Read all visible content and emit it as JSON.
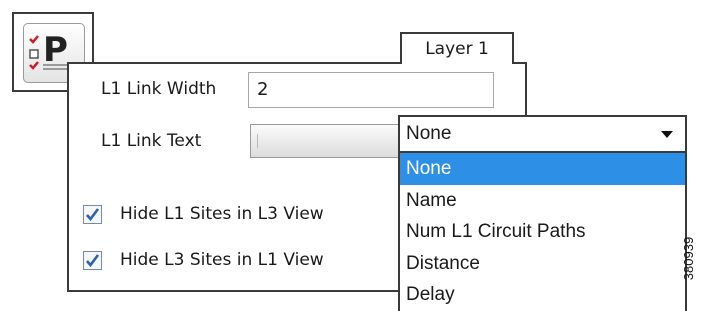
{
  "toolbar": {
    "properties_icon": "properties-icon"
  },
  "tab": {
    "label": "Layer 1"
  },
  "fields": {
    "link_width": {
      "label": "L1 Link Width",
      "value": "2"
    },
    "link_text": {
      "label": "L1 Link Text",
      "selected": "None"
    }
  },
  "checkboxes": [
    {
      "label": "Hide L1 Sites in L3 View",
      "checked": true
    },
    {
      "label": "Hide L3 Sites in L1 View",
      "checked": true
    }
  ],
  "dropdown": {
    "options": [
      "None",
      "Name",
      "Num L1 Circuit Paths",
      "Distance",
      "Delay"
    ],
    "highlighted": "None"
  },
  "figure_id": "380939",
  "colors": {
    "highlight": "#2e8fe6",
    "check": "#2e62b0",
    "icon_red": "#c8202a"
  }
}
